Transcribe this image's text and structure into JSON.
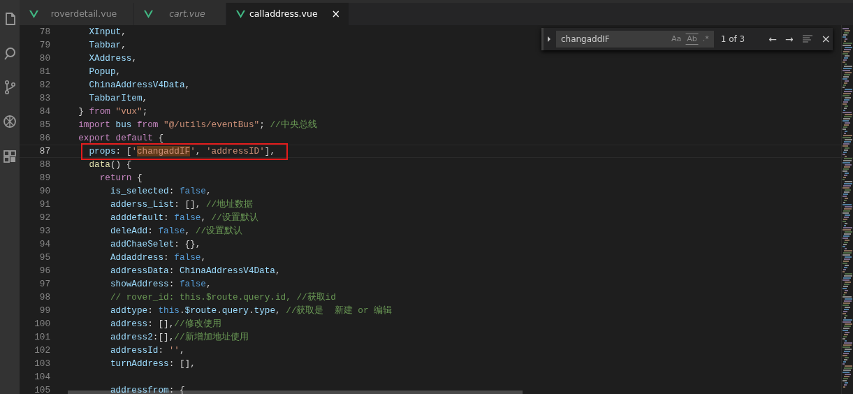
{
  "tabs": [
    {
      "label": "roverdetail.vue",
      "selected": false,
      "preview": false
    },
    {
      "label": "cart.vue",
      "selected": false,
      "preview": true
    },
    {
      "label": "calladdress.vue",
      "selected": true,
      "preview": false,
      "close": "×"
    }
  ],
  "find_widget": {
    "query": "changaddIF",
    "toggles": [
      {
        "label": "Aa",
        "on": false
      },
      {
        "label": "Ab",
        "on": false
      },
      {
        "label": ".*",
        "on": false
      }
    ],
    "count": "1 of 3",
    "buttons": [
      {
        "label": "←"
      },
      {
        "label": "→"
      }
    ],
    "close": "×"
  },
  "lines": [
    {
      "number": "78",
      "current": false,
      "boxed": false,
      "tokens": [
        {
          "text": "    XInput",
          "kind": "name"
        },
        {
          "text": ",",
          "kind": "plain"
        }
      ]
    },
    {
      "number": "79",
      "current": false,
      "boxed": false,
      "tokens": [
        {
          "text": "    Tabbar",
          "kind": "name"
        },
        {
          "text": ",",
          "kind": "plain"
        }
      ]
    },
    {
      "number": "80",
      "current": false,
      "boxed": false,
      "tokens": [
        {
          "text": "    XAddress",
          "kind": "name"
        },
        {
          "text": ",",
          "kind": "plain"
        }
      ]
    },
    {
      "number": "81",
      "current": false,
      "boxed": false,
      "tokens": [
        {
          "text": "    Popup",
          "kind": "name"
        },
        {
          "text": ",",
          "kind": "plain"
        }
      ]
    },
    {
      "number": "82",
      "current": false,
      "boxed": false,
      "tokens": [
        {
          "text": "    ChinaAddressV4Data",
          "kind": "name"
        },
        {
          "text": ",",
          "kind": "plain"
        }
      ]
    },
    {
      "number": "83",
      "current": false,
      "boxed": false,
      "tokens": [
        {
          "text": "    TabbarItem",
          "kind": "name"
        },
        {
          "text": ",",
          "kind": "plain"
        }
      ]
    },
    {
      "number": "84",
      "current": false,
      "boxed": false,
      "tokens": [
        {
          "text": "  } ",
          "kind": "plain"
        },
        {
          "text": "from",
          "kind": "keyword"
        },
        {
          "text": " \"vux\"",
          "kind": "string"
        },
        {
          "text": ";",
          "kind": "plain"
        }
      ]
    },
    {
      "number": "85",
      "current": false,
      "boxed": false,
      "tokens": [
        {
          "text": "  import",
          "kind": "keyword"
        },
        {
          "text": " bus",
          "kind": "name"
        },
        {
          "text": " from",
          "kind": "keyword"
        },
        {
          "text": " \"@/utils/eventBus\"",
          "kind": "string"
        },
        {
          "text": "; ",
          "kind": "plain"
        },
        {
          "text": "//中央总线",
          "kind": "comment"
        }
      ]
    },
    {
      "number": "86",
      "current": false,
      "boxed": false,
      "tokens": [
        {
          "text": "  export default",
          "kind": "keyword"
        },
        {
          "text": " {",
          "kind": "plain"
        }
      ]
    },
    {
      "number": "87",
      "current": true,
      "boxed": true,
      "tokens": [
        {
          "text": "    props",
          "kind": "name"
        },
        {
          "text": ": [",
          "kind": "plain"
        },
        {
          "text": "'",
          "kind": "string"
        },
        {
          "text": "changaddIF",
          "kind": "match"
        },
        {
          "text": "'",
          "kind": "string"
        },
        {
          "text": ", ",
          "kind": "plain"
        },
        {
          "text": "'addressID'",
          "kind": "string"
        },
        {
          "text": "],",
          "kind": "plain"
        }
      ]
    },
    {
      "number": "88",
      "current": false,
      "boxed": false,
      "tokens": [
        {
          "text": "    data",
          "kind": "function"
        },
        {
          "text": "() {",
          "kind": "plain"
        }
      ]
    },
    {
      "number": "89",
      "current": false,
      "boxed": false,
      "tokens": [
        {
          "text": "      return",
          "kind": "keyword"
        },
        {
          "text": " {",
          "kind": "plain"
        }
      ]
    },
    {
      "number": "90",
      "current": false,
      "boxed": false,
      "tokens": [
        {
          "text": "        is_selected",
          "kind": "name"
        },
        {
          "text": ": ",
          "kind": "plain"
        },
        {
          "text": "false",
          "kind": "constant"
        },
        {
          "text": ",",
          "kind": "plain"
        }
      ]
    },
    {
      "number": "91",
      "current": false,
      "boxed": false,
      "tokens": [
        {
          "text": "        adderss_List",
          "kind": "name"
        },
        {
          "text": ": [], ",
          "kind": "plain"
        },
        {
          "text": "//地址数据",
          "kind": "comment"
        }
      ]
    },
    {
      "number": "92",
      "current": false,
      "boxed": false,
      "tokens": [
        {
          "text": "        adddefault",
          "kind": "name"
        },
        {
          "text": ": ",
          "kind": "plain"
        },
        {
          "text": "false",
          "kind": "constant"
        },
        {
          "text": ", ",
          "kind": "plain"
        },
        {
          "text": "//设置默认",
          "kind": "comment"
        }
      ]
    },
    {
      "number": "93",
      "current": false,
      "boxed": false,
      "tokens": [
        {
          "text": "        deleAdd",
          "kind": "name"
        },
        {
          "text": ": ",
          "kind": "plain"
        },
        {
          "text": "false",
          "kind": "constant"
        },
        {
          "text": ", ",
          "kind": "plain"
        },
        {
          "text": "//设置默认",
          "kind": "comment"
        }
      ]
    },
    {
      "number": "94",
      "current": false,
      "boxed": false,
      "tokens": [
        {
          "text": "        addChaeSelet",
          "kind": "name"
        },
        {
          "text": ": {},",
          "kind": "plain"
        }
      ]
    },
    {
      "number": "95",
      "current": false,
      "boxed": false,
      "tokens": [
        {
          "text": "        Addaddress",
          "kind": "name"
        },
        {
          "text": ": ",
          "kind": "plain"
        },
        {
          "text": "false",
          "kind": "constant"
        },
        {
          "text": ",",
          "kind": "plain"
        }
      ]
    },
    {
      "number": "96",
      "current": false,
      "boxed": false,
      "tokens": [
        {
          "text": "        addressData",
          "kind": "name"
        },
        {
          "text": ": ",
          "kind": "plain"
        },
        {
          "text": "ChinaAddressV4Data",
          "kind": "name"
        },
        {
          "text": ",",
          "kind": "plain"
        }
      ]
    },
    {
      "number": "97",
      "current": false,
      "boxed": false,
      "tokens": [
        {
          "text": "        showAddress",
          "kind": "name"
        },
        {
          "text": ": ",
          "kind": "plain"
        },
        {
          "text": "false",
          "kind": "constant"
        },
        {
          "text": ",",
          "kind": "plain"
        }
      ]
    },
    {
      "number": "98",
      "current": false,
      "boxed": false,
      "tokens": [
        {
          "text": "        // rover_id: this.$route.query.id, //获取id",
          "kind": "comment"
        }
      ]
    },
    {
      "number": "99",
      "current": false,
      "boxed": false,
      "tokens": [
        {
          "text": "        addtype",
          "kind": "name"
        },
        {
          "text": ": ",
          "kind": "plain"
        },
        {
          "text": "this",
          "kind": "constant"
        },
        {
          "text": ".",
          "kind": "plain"
        },
        {
          "text": "$route",
          "kind": "name"
        },
        {
          "text": ".",
          "kind": "plain"
        },
        {
          "text": "query",
          "kind": "name"
        },
        {
          "text": ".",
          "kind": "plain"
        },
        {
          "text": "type",
          "kind": "name"
        },
        {
          "text": ", ",
          "kind": "plain"
        },
        {
          "text": "//获取是  新建 or 编辑",
          "kind": "comment"
        }
      ]
    },
    {
      "number": "100",
      "current": false,
      "boxed": false,
      "tokens": [
        {
          "text": "        address",
          "kind": "name"
        },
        {
          "text": ": [],",
          "kind": "plain"
        },
        {
          "text": "//修改使用",
          "kind": "comment"
        }
      ]
    },
    {
      "number": "101",
      "current": false,
      "boxed": false,
      "tokens": [
        {
          "text": "        address2",
          "kind": "name"
        },
        {
          "text": ":[],",
          "kind": "plain"
        },
        {
          "text": "//新增加地址使用",
          "kind": "comment"
        }
      ]
    },
    {
      "number": "102",
      "current": false,
      "boxed": false,
      "tokens": [
        {
          "text": "        addressId",
          "kind": "name"
        },
        {
          "text": ": ",
          "kind": "plain"
        },
        {
          "text": "''",
          "kind": "string"
        },
        {
          "text": ",",
          "kind": "plain"
        }
      ]
    },
    {
      "number": "103",
      "current": false,
      "boxed": false,
      "tokens": [
        {
          "text": "        turnAddress",
          "kind": "name"
        },
        {
          "text": ": [],",
          "kind": "plain"
        }
      ]
    },
    {
      "number": "104",
      "current": false,
      "boxed": false
    },
    {
      "number": "105",
      "current": false,
      "boxed": false,
      "tokens": [
        {
          "text": "        addressfrom",
          "kind": "name"
        },
        {
          "text": ": {",
          "kind": "plain"
        }
      ]
    }
  ]
}
